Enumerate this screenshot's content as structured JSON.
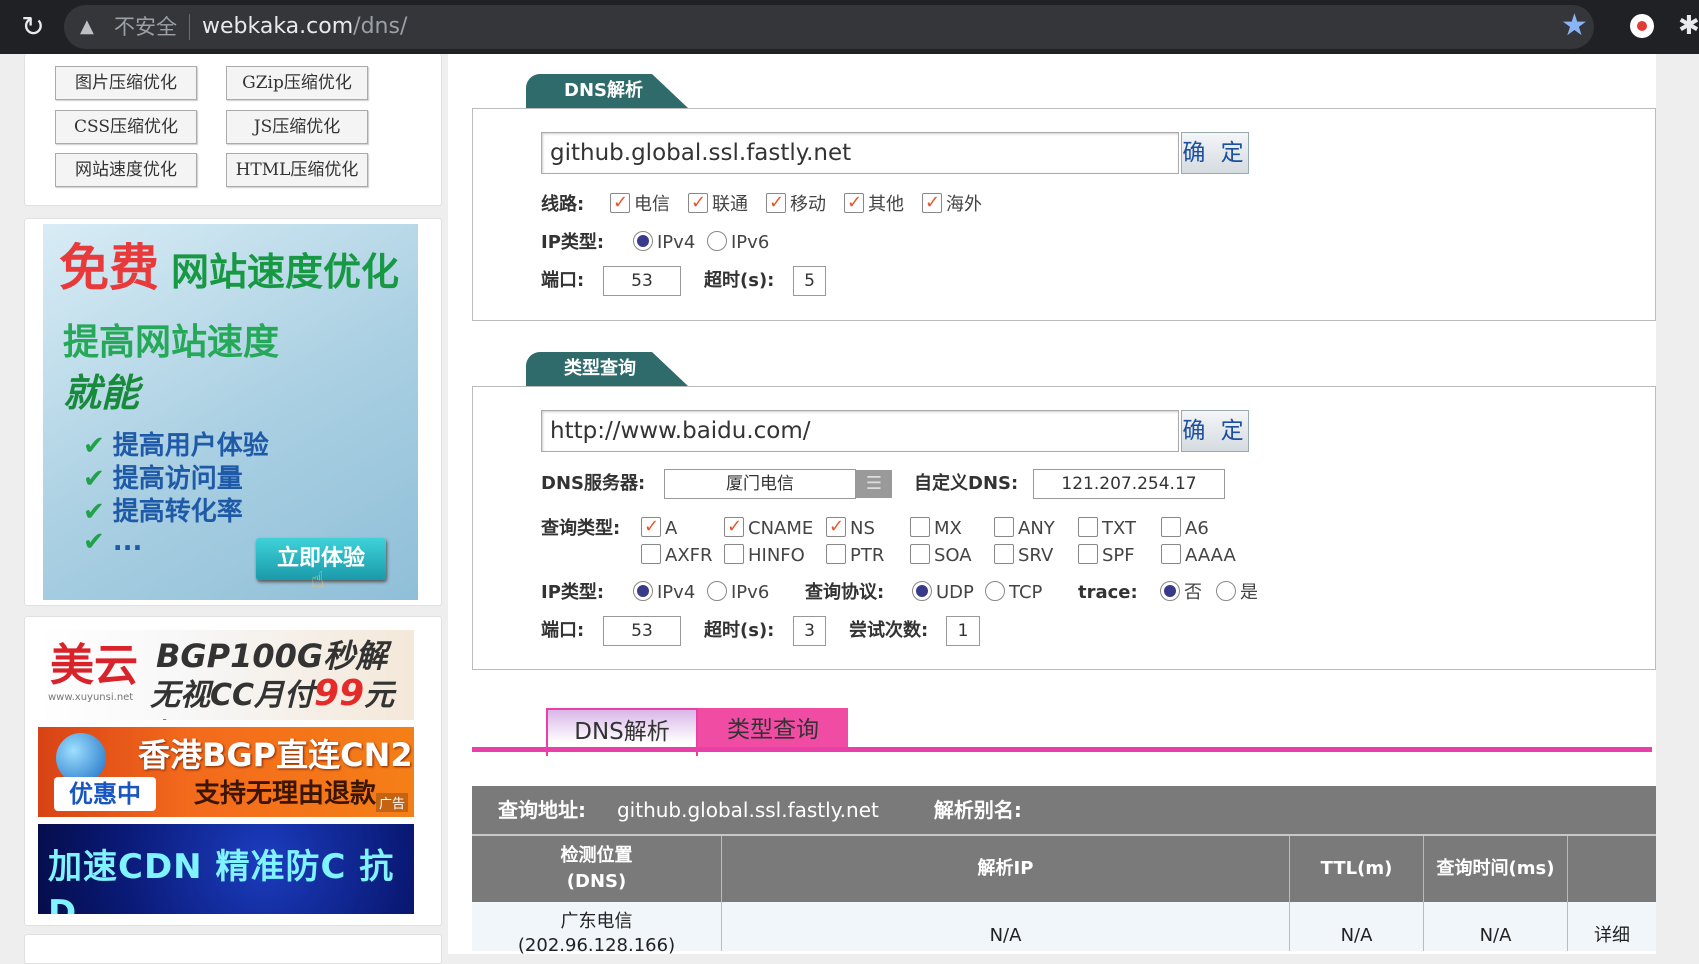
{
  "browser": {
    "security_label": "不安全",
    "url_host": "webkaka.com",
    "url_path": "/dns/"
  },
  "sidebar": {
    "tools": [
      "图片压缩优化",
      "GZip压缩优化",
      "CSS压缩优化",
      "JS压缩优化",
      "网站速度优化",
      "HTML压缩优化"
    ],
    "ad1": {
      "free": "免费",
      "headline": "网站速度优化",
      "line1": "提高网站速度",
      "line2": "就能",
      "bullets": [
        "提高用户体验",
        "提高访问量",
        "提高转化率",
        "..."
      ],
      "cta": "立即体验"
    },
    "ad2": {
      "logo": "美云",
      "logo_sub": "www.xuyunsi.net",
      "line1": "BGP100G秒解",
      "line2_pre": "无视CC月付",
      "line2_num": "99",
      "line2_post": "元起"
    },
    "ad3": {
      "promo": "优惠中",
      "line1": "香港BGP直连CN2",
      "line2": "支持无理由退款",
      "tag": "广告"
    },
    "ad4": {
      "line1": "加速CDN 精准防C 抗D"
    }
  },
  "dns_section": {
    "tab_label": "DNS解析",
    "domain_value": "github.global.ssl.fastly.net",
    "submit_label": "确 定",
    "line_label": "线路:",
    "lines": [
      {
        "label": "电信",
        "checked": true
      },
      {
        "label": "联通",
        "checked": true
      },
      {
        "label": "移动",
        "checked": true
      },
      {
        "label": "其他",
        "checked": true
      },
      {
        "label": "海外",
        "checked": true
      }
    ],
    "ip_type_label": "IP类型:",
    "ipv4": "IPv4",
    "ipv6": "IPv6",
    "port_label": "端口:",
    "port_value": "53",
    "timeout_label": "超时(s):",
    "timeout_value": "5"
  },
  "type_section": {
    "tab_label": "类型查询",
    "url_value": "http://www.baidu.com/",
    "submit_label": "确 定",
    "dns_server_label": "DNS服务器:",
    "dns_server_value": "厦门电信",
    "custom_dns_label": "自定义DNS:",
    "custom_dns_value": "121.207.254.17",
    "query_type_label": "查询类型:",
    "types_row1": [
      {
        "label": "A",
        "checked": true
      },
      {
        "label": "CNAME",
        "checked": true
      },
      {
        "label": "NS",
        "checked": true
      },
      {
        "label": "MX",
        "checked": false
      },
      {
        "label": "ANY",
        "checked": false
      },
      {
        "label": "TXT",
        "checked": false
      },
      {
        "label": "A6",
        "checked": false
      }
    ],
    "types_row2": [
      {
        "label": "AXFR",
        "checked": false
      },
      {
        "label": "HINFO",
        "checked": false
      },
      {
        "label": "PTR",
        "checked": false
      },
      {
        "label": "SOA",
        "checked": false
      },
      {
        "label": "SRV",
        "checked": false
      },
      {
        "label": "SPF",
        "checked": false
      },
      {
        "label": "AAAA",
        "checked": false
      }
    ],
    "ip_type_label": "IP类型:",
    "ipv4": "IPv4",
    "ipv6": "IPv6",
    "protocol_label": "查询协议:",
    "udp": "UDP",
    "tcp": "TCP",
    "trace_label": "trace:",
    "trace_no": "否",
    "trace_yes": "是",
    "port_label": "端口:",
    "port_value": "53",
    "timeout_label": "超时(s):",
    "timeout_value": "3",
    "retries_label": "尝试次数:",
    "retries_value": "1"
  },
  "result_tabs": {
    "dns": "DNS解析",
    "type": "类型查询"
  },
  "results": {
    "query_label": "查询地址:",
    "query_value": "github.global.ssl.fastly.net",
    "alias_label": "解析别名:",
    "headers": {
      "location_l1": "检测位置",
      "location_l2": "(DNS)",
      "ip": "解析IP",
      "ttl": "TTL(m)",
      "time": "查询时间(ms)"
    },
    "rows": [
      {
        "location": "广东电信",
        "dns": "(202.96.128.166)",
        "ip": "N/A",
        "ttl": "N/A",
        "time": "N/A",
        "detail": "详细"
      }
    ]
  }
}
